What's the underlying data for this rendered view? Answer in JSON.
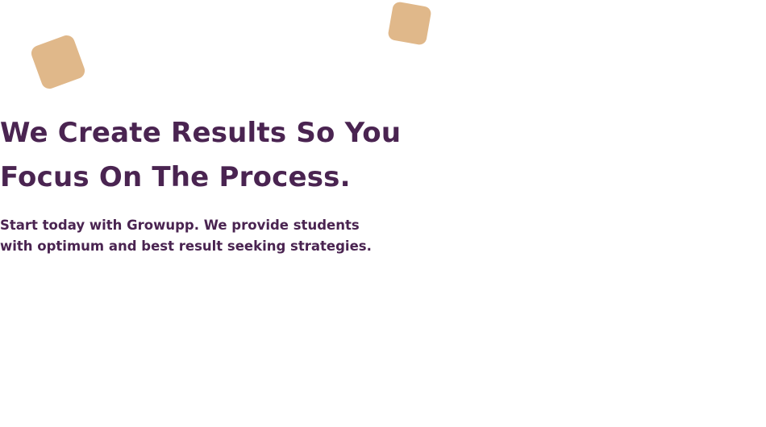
{
  "colors": {
    "heading": "#4a2451",
    "accent_shape": "#e0b88a",
    "background": "#ffffff"
  },
  "hero": {
    "title_line1": "We Create Results So You",
    "title_line2": "Focus On The Process.",
    "subtitle_line1": "Start today with Growupp. We provide students",
    "subtitle_line2": "with optimum and best result seeking strategies."
  },
  "decorations": [
    {
      "shape": "rounded-square"
    },
    {
      "shape": "rounded-square"
    }
  ]
}
